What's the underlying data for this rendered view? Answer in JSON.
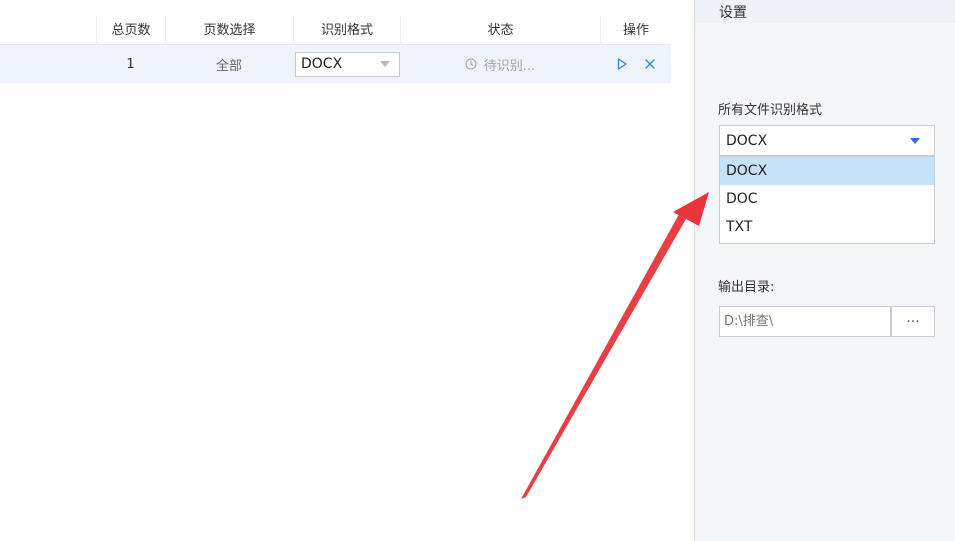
{
  "table": {
    "columns": [
      "",
      "总页数",
      "页数选择",
      "识别格式",
      "状态",
      "操作"
    ],
    "rows": [
      {
        "name": "",
        "total_pages": "1",
        "page_selection": "全部",
        "format": "DOCX",
        "status": "待识别..."
      }
    ]
  },
  "settings": {
    "title": "设置",
    "format_label": "所有文件识别格式",
    "format_selected": "DOCX",
    "format_options": [
      "DOCX",
      "DOC",
      "TXT"
    ],
    "output_label": "输出目录:",
    "output_path_placeholder": "D:\\排查\\",
    "browse_label": "···"
  },
  "colors": {
    "row_highlight": "#eef4fc",
    "selected_option": "#c5e2fb",
    "accent_blue": "#2f6fd6",
    "annotation_arrow": "#e8343a"
  },
  "icons": {
    "status": "clock-icon",
    "start": "play-icon",
    "remove": "close-icon",
    "dropdown": "caret-down-icon",
    "annotation": "arrow-annotation"
  }
}
